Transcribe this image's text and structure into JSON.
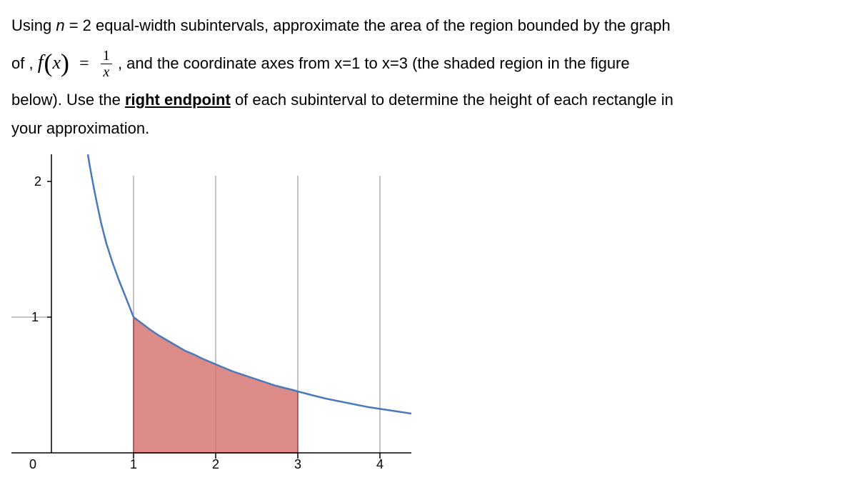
{
  "question": {
    "line1_a": "Using  ",
    "line1_n": "n",
    "line1_b": " = 2   equal-width subintervals, approximate the area of the region bounded by the graph",
    "line2_a": "of ,   ",
    "line2_b": " ,   and the coordinate axes from x=1 to x=3 (the shaded region in the figure",
    "line3": "below). Use the ",
    "line3_emph": "right endpoint",
    "line3_b": " of each subinterval to determine the height of each rectangle in",
    "line4": "your approximation."
  },
  "formula": {
    "f": "f",
    "lp": "(",
    "x": "x",
    "rp": ")",
    "eq": "=",
    "num": "1",
    "den": "x"
  },
  "chart_data": {
    "type": "area",
    "function": "1/x",
    "x_range_plot": [
      0.35,
      5.5
    ],
    "shaded_x_range": [
      1,
      3
    ],
    "xlabel": "",
    "ylabel": "",
    "xlim": [
      0,
      5.5
    ],
    "ylim": [
      0,
      2.2
    ],
    "x_ticks": [
      0,
      1,
      2,
      3,
      4
    ],
    "y_ticks": [
      1,
      2
    ],
    "grid_x": [
      1,
      2,
      3,
      4
    ],
    "grid_y": [
      1
    ],
    "series": [
      {
        "name": "f(x)=1/x",
        "type": "curve"
      },
      {
        "name": "shaded region under f from 1 to 3",
        "type": "area"
      }
    ]
  },
  "axis_labels": {
    "x0": "0",
    "x1": "1",
    "x2": "2",
    "x3": "3",
    "x4": "4",
    "y1": "1",
    "y2": "2"
  }
}
